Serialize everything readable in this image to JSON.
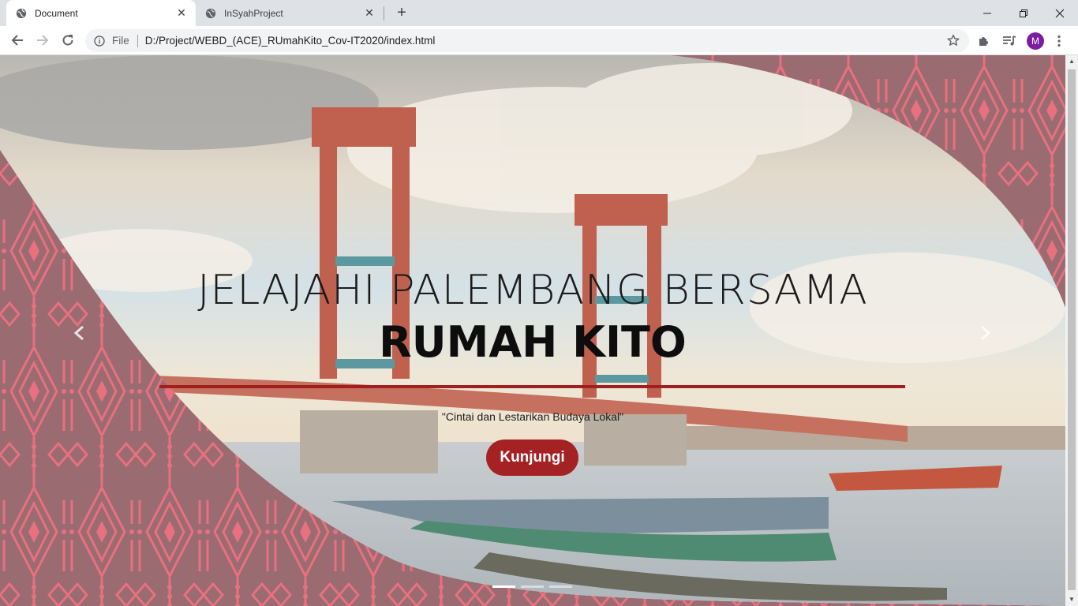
{
  "browser": {
    "tabs": [
      {
        "title": "Document",
        "active": true
      },
      {
        "title": "InSyahProject",
        "active": false
      }
    ],
    "address": {
      "scheme_label": "File",
      "url": "D:/Project/WEBD_(ACE)_RUmahKito_Cov-IT2020/index.html"
    },
    "profile_initial": "M"
  },
  "hero": {
    "heading": "JELAJAHI PALEMBANG BERSAMA",
    "title": "RUMAH KITO",
    "quote": "\"Cintai dan Lestarikan Budaya Lokal\"",
    "button_label": "Kunjungi"
  },
  "carousel": {
    "slide_count": 3,
    "active_index": 0
  },
  "colors": {
    "motif_background": "#9a6b71",
    "motif_pattern": "#e8707f",
    "accent": "#a52224"
  }
}
